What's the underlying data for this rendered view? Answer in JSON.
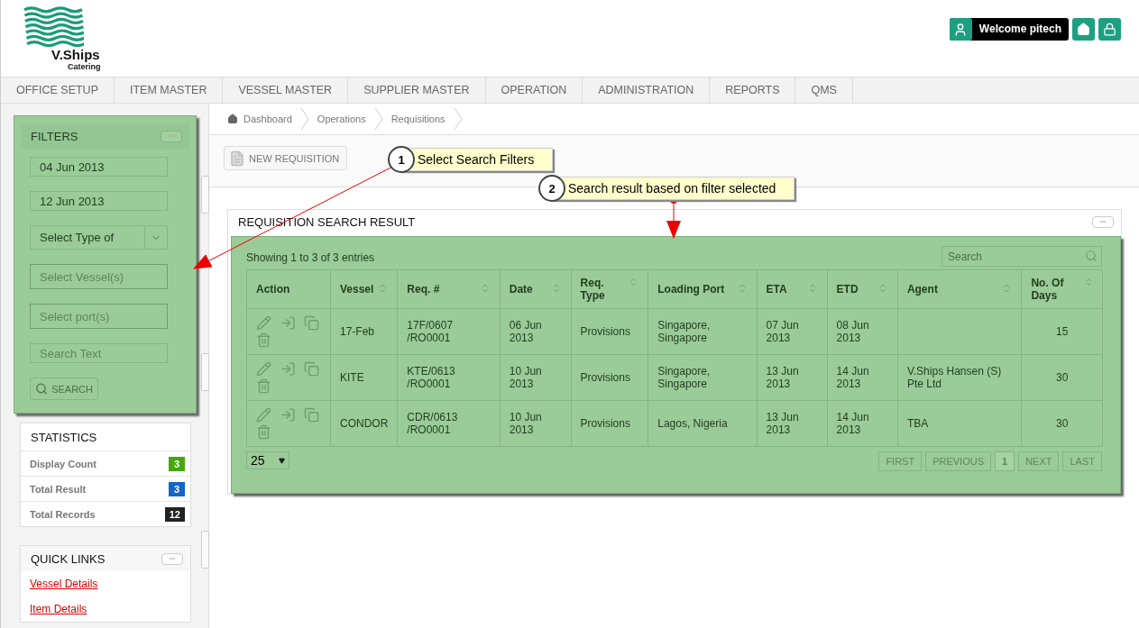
{
  "header": {
    "logo_name": "V.Ships",
    "logo_sub": "Catering",
    "welcome": "Welcome pitech"
  },
  "nav": [
    "OFFICE SETUP",
    "ITEM MASTER",
    "VESSEL MASTER",
    "SUPPLIER MASTER",
    "OPERATION",
    "ADMINISTRATION",
    "REPORTS",
    "QMS"
  ],
  "filters": {
    "title": "FILTERS",
    "fields": [
      {
        "kind": "input",
        "value": "04 Jun 2013"
      },
      {
        "kind": "input",
        "value": "12 Jun 2013"
      },
      {
        "kind": "select",
        "value": "Select Type of"
      },
      {
        "kind": "multi",
        "placeholder": "Select Vessel(s)"
      },
      {
        "kind": "multi",
        "placeholder": "Select port(s)"
      },
      {
        "kind": "input",
        "placeholder": "Search Text"
      }
    ],
    "search_button": "SEARCH"
  },
  "statistics": {
    "title": "STATISTICS",
    "rows": [
      {
        "label": "Display Count",
        "value": "3",
        "color": "#45a80f"
      },
      {
        "label": "Total Result",
        "value": "3",
        "color": "#1565c8"
      },
      {
        "label": "Total Records",
        "value": "12",
        "color": "#222222"
      }
    ]
  },
  "quick_links": {
    "title": "QUICK LINKS",
    "links": [
      "Vessel Details",
      "Item Details"
    ]
  },
  "breadcrumb": [
    "Dashboard",
    "Operations",
    "Requisitions"
  ],
  "new_requisition": "NEW REQUISITION",
  "results": {
    "title": "REQUISITION SEARCH RESULT",
    "info": "Showing 1 to 3 of 3 entries",
    "search_placeholder": "Search",
    "columns": [
      {
        "label": "Action",
        "sortable": false
      },
      {
        "label": "Vessel",
        "sortable": true
      },
      {
        "label": "Req. #",
        "sortable": true
      },
      {
        "label": "Date",
        "sortable": true
      },
      {
        "label": "Req. Type",
        "sortable": true
      },
      {
        "label": "Loading Port",
        "sortable": true
      },
      {
        "label": "ETA",
        "sortable": true
      },
      {
        "label": "ETD",
        "sortable": true
      },
      {
        "label": "Agent",
        "sortable": true
      },
      {
        "label": "No. Of Days",
        "sortable": true
      }
    ],
    "rows": [
      {
        "vessel": "17-Feb",
        "req_no": "17F/0607 /RO0001",
        "date": "06 Jun 2013",
        "req_type": "Provisions",
        "loading_port": "Singapore, Singapore",
        "eta": "07 Jun 2013",
        "etd": "08 Jun 2013",
        "days": "15"
      },
      {
        "vessel": "KITE",
        "req_no": "KTE/0613 /RO0001",
        "date": "10 Jun 2013",
        "req_type": "Provisions",
        "loading_port": "Singapore, Singapore",
        "eta": "13 Jun 2013",
        "etd": "14 Jun 2013",
        "agent": "V.Ships Hansen (S) Pte Ltd",
        "days": "30"
      },
      {
        "vessel": "CONDOR",
        "req_no": "CDR/0613 /RO0001",
        "date": "10 Jun 2013",
        "req_type": "Provisions",
        "loading_port": "Lagos, Nigeria",
        "eta": "13 Jun 2013",
        "etd": "14 Jun 2013",
        "agent": "TBA",
        "days": "30"
      }
    ],
    "page_size": "25",
    "pagination": [
      {
        "label": "FIRST",
        "selected": false
      },
      {
        "label": "PREVIOUS",
        "selected": false
      },
      {
        "label": "1",
        "selected": true
      },
      {
        "label": "NEXT",
        "selected": false
      },
      {
        "label": "LAST",
        "selected": false
      }
    ]
  },
  "callouts": [
    {
      "number": "1",
      "text": "Select Search Filters"
    },
    {
      "number": "2",
      "text": "Search result based on filter selected"
    }
  ]
}
